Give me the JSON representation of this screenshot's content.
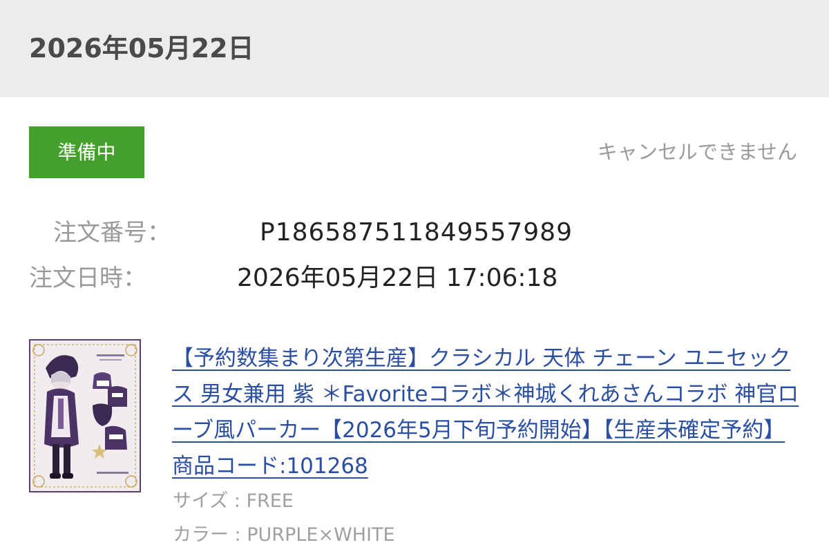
{
  "header": {
    "date": "2026年05月22日"
  },
  "order": {
    "status": "準備中",
    "status_color": "#43a02c",
    "cancel_note": "キャンセルできません",
    "number_label": "注文番号：",
    "number": "P1865875118495579​89",
    "date_label": "注文日時：",
    "datetime": "2026年05月22日 17:06:18"
  },
  "product": {
    "thumbnail_icon": "product-image-icon",
    "title": "【予約数集まり次第生産】クラシカル 天体 チェーン ユニセックス 男女兼用 紫 ＊Favoriteコラボ＊神城くれあさんコラボ 神官ローブ風パーカー【2026年5月下旬予約開始】【生産未確定予約】商品コード:101268",
    "size_label": "サイズ : FREE",
    "color_label": "カラー : PURPLE×WHITE",
    "link_color": "#2b4fa0"
  }
}
